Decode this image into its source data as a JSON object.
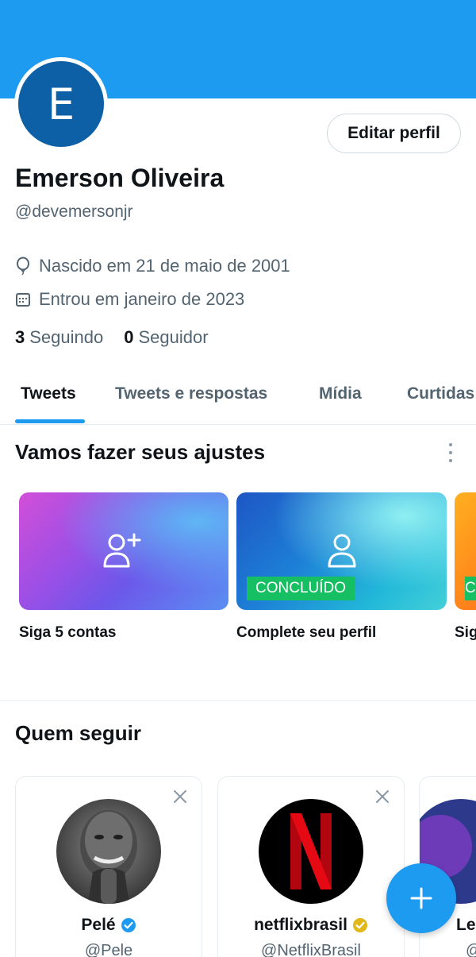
{
  "profile": {
    "avatar_letter": "E",
    "edit_label": "Editar perfil",
    "name": "Emerson Oliveira",
    "handle": "@devemersonjr",
    "birth": "Nascido em 21 de maio de 2001",
    "joined": "Entrou em janeiro de 2023",
    "following_count": "3",
    "following_label": "Seguindo",
    "followers_count": "0",
    "followers_label": "Seguidor"
  },
  "tabs": [
    "Tweets",
    "Tweets e respostas",
    "Mídia",
    "Curtidas"
  ],
  "active_tab": "Tweets",
  "setup": {
    "title": "Vamos fazer seus ajustes",
    "cards": [
      {
        "label": "Siga 5 contas",
        "icon": "add-user-icon",
        "done": false
      },
      {
        "label": "Complete seu perfil",
        "icon": "user-icon",
        "done": true,
        "badge": "CONCLUÍDO"
      },
      {
        "label": "Sig",
        "done": true,
        "badge": "C"
      }
    ]
  },
  "who_to_follow": {
    "title": "Quem seguir",
    "accounts": [
      {
        "name": "Pelé",
        "handle": "@Pele",
        "verified": "blue"
      },
      {
        "name": "netflixbrasil",
        "handle": "@NetflixBrasil",
        "verified": "gold"
      },
      {
        "name": "Le",
        "handle": "@"
      }
    ]
  },
  "colors": {
    "accent": "#1d9bf0",
    "avatar_bg": "#0d5fa6",
    "done_badge": "#17bf63",
    "verified_blue": "#1d9bf0",
    "verified_gold": "#e2b719",
    "netflix_red": "#e50914"
  }
}
